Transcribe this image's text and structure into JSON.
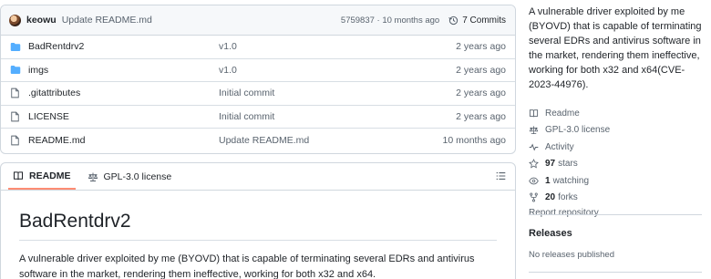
{
  "commit": {
    "author": "keowu",
    "message": "Update README.md",
    "hash_time": "5759837 · 10 months ago",
    "commits_label": "7 Commits"
  },
  "files": [
    {
      "type": "folder",
      "name": "BadRentdrv2",
      "commit": "v1.0",
      "age": "2 years ago"
    },
    {
      "type": "folder",
      "name": "imgs",
      "commit": "v1.0",
      "age": "2 years ago"
    },
    {
      "type": "file",
      "name": ".gitattributes",
      "commit": "Initial commit",
      "age": "2 years ago"
    },
    {
      "type": "file",
      "name": "LICENSE",
      "commit": "Initial commit",
      "age": "2 years ago"
    },
    {
      "type": "file",
      "name": "README.md",
      "commit": "Update README.md",
      "age": "10 months ago"
    }
  ],
  "readme": {
    "tabs": [
      "README",
      "GPL-3.0 license"
    ],
    "title": "BadRentdrv2",
    "paragraph": "A vulnerable driver exploited by me (BYOVD) that is capable of terminating several EDRs and antivirus software in the market, rendering them ineffective, working for both x32 and x64."
  },
  "sidebar": {
    "about": "A vulnerable driver exploited by me (BYOVD) that is capable of terminating several EDRs and antivirus software in the market, rendering them ineffective, working for both x32 and x64(CVE-2023-44976).",
    "links": [
      {
        "icon": "book-icon",
        "label": "Readme"
      },
      {
        "icon": "scale-icon",
        "label": "GPL-3.0 license"
      },
      {
        "icon": "pulse-icon",
        "label": "Activity"
      }
    ],
    "stats": [
      {
        "icon": "star-icon",
        "count": "97",
        "label": "stars"
      },
      {
        "icon": "eye-icon",
        "count": "1",
        "label": "watching"
      },
      {
        "icon": "fork-icon",
        "count": "20",
        "label": "forks"
      }
    ],
    "report": "Report repository",
    "releases_heading": "Releases",
    "releases_empty": "No releases published"
  },
  "colors": {
    "folder": "#54aeff",
    "tab_underline": "#fd8c73",
    "muted": "#59636e",
    "border": "#d0d7de"
  }
}
